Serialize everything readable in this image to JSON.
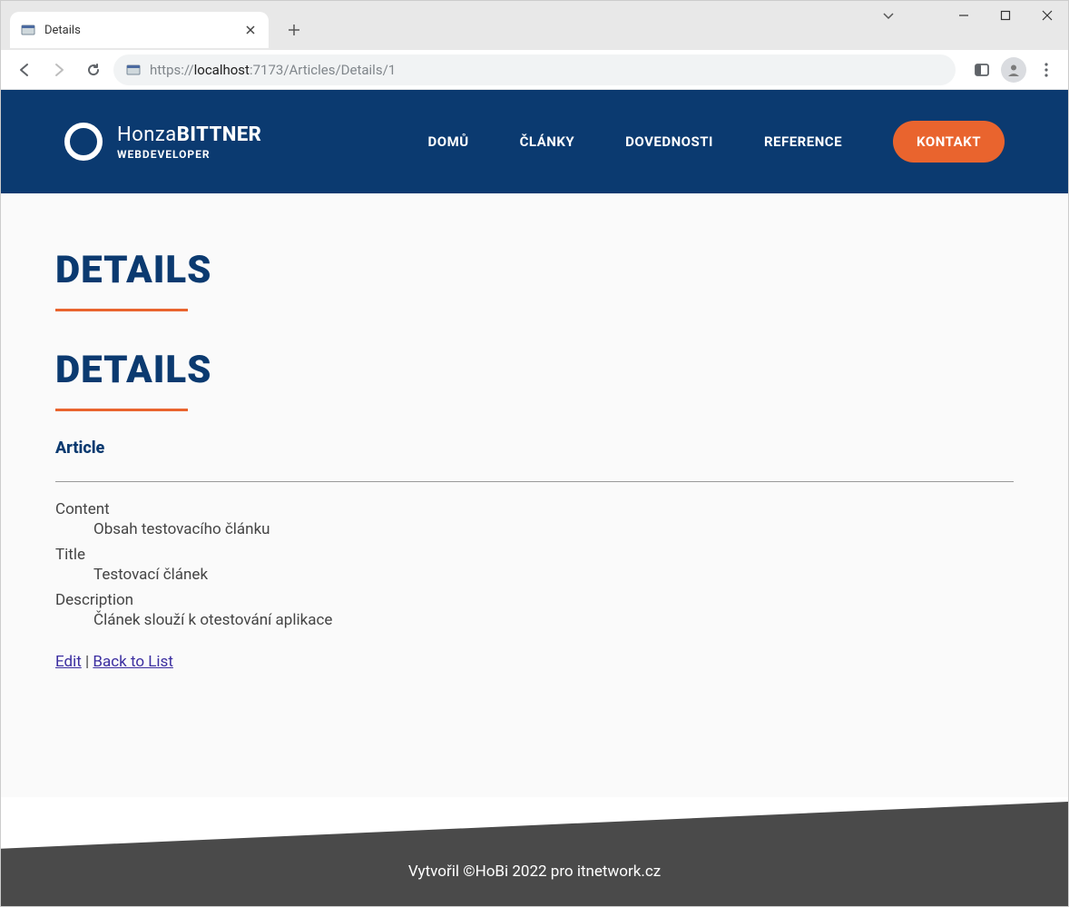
{
  "browser": {
    "tab_title": "Details",
    "url_pre": "https://",
    "url_host": "localhost",
    "url_port": ":7173",
    "url_path": "/Articles/Details/1"
  },
  "header": {
    "name_first": "Honza",
    "name_last": "BITTNER",
    "subtitle": "WEBDEVELOPER",
    "nav": {
      "home": "DOMŮ",
      "articles": "ČLÁNKY",
      "skills": "DOVEDNOSTI",
      "reference": "REFERENCE",
      "contact": "KONTAKT"
    }
  },
  "page": {
    "heading1": "DETAILS",
    "heading2": "DETAILS",
    "subheading": "Article",
    "fields": {
      "content_label": "Content",
      "content_value": "Obsah testovacího článku",
      "title_label": "Title",
      "title_value": "Testovací článek",
      "description_label": "Description",
      "description_value": "Článek slouží k otestování aplikace"
    },
    "links": {
      "edit": "Edit",
      "separator": " | ",
      "back": "Back to List"
    }
  },
  "footer": {
    "text": "Vytvořil ©HoBi 2022 pro itnetwork.cz"
  }
}
